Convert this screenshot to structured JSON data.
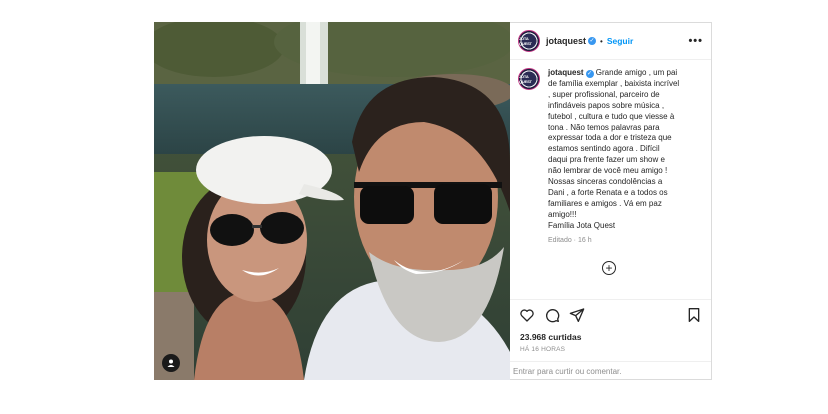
{
  "account": {
    "username": "jotaquest",
    "avatar_text": "JOTA QUEST",
    "verified": true,
    "follow_label": "Seguir",
    "more_label": "•••"
  },
  "caption": {
    "text": "Grande amigo , um pai\nde família exemplar , baixista incrível\n, super profissional, parceiro de\ninfindáveis papos sobre música ,\nfutebol , cultura e tudo que viesse à\ntona . Não temos palavras para\nexpressar toda a dor e tristeza que\nestamos sentindo agora . Difícil\ndaqui pra frente fazer um show e\nnão lembrar de você meu amigo !\nNossas sinceras condolências a\nDani , a forte Renata e a todos os\nfamiliares e amigos . Vá em paz\namigo!!!\nFamília Jota Quest",
    "edited": "Editado · 16 h"
  },
  "add_comment_icon": "plus-circle",
  "actions": {
    "like_icon": "heart",
    "comment_icon": "speech-bubble",
    "share_icon": "paper-plane",
    "save_icon": "bookmark"
  },
  "likes": "23.968 curtidas",
  "time_ago": "HÁ 16 HORAS",
  "comment_box": {
    "placeholder": "Entrar para curtir ou comentar."
  },
  "colors": {
    "link_blue": "#0095f6",
    "verified_blue": "#3897f0",
    "text": "#262626",
    "muted": "#8e8e8e",
    "border": "#dbdbdb"
  }
}
